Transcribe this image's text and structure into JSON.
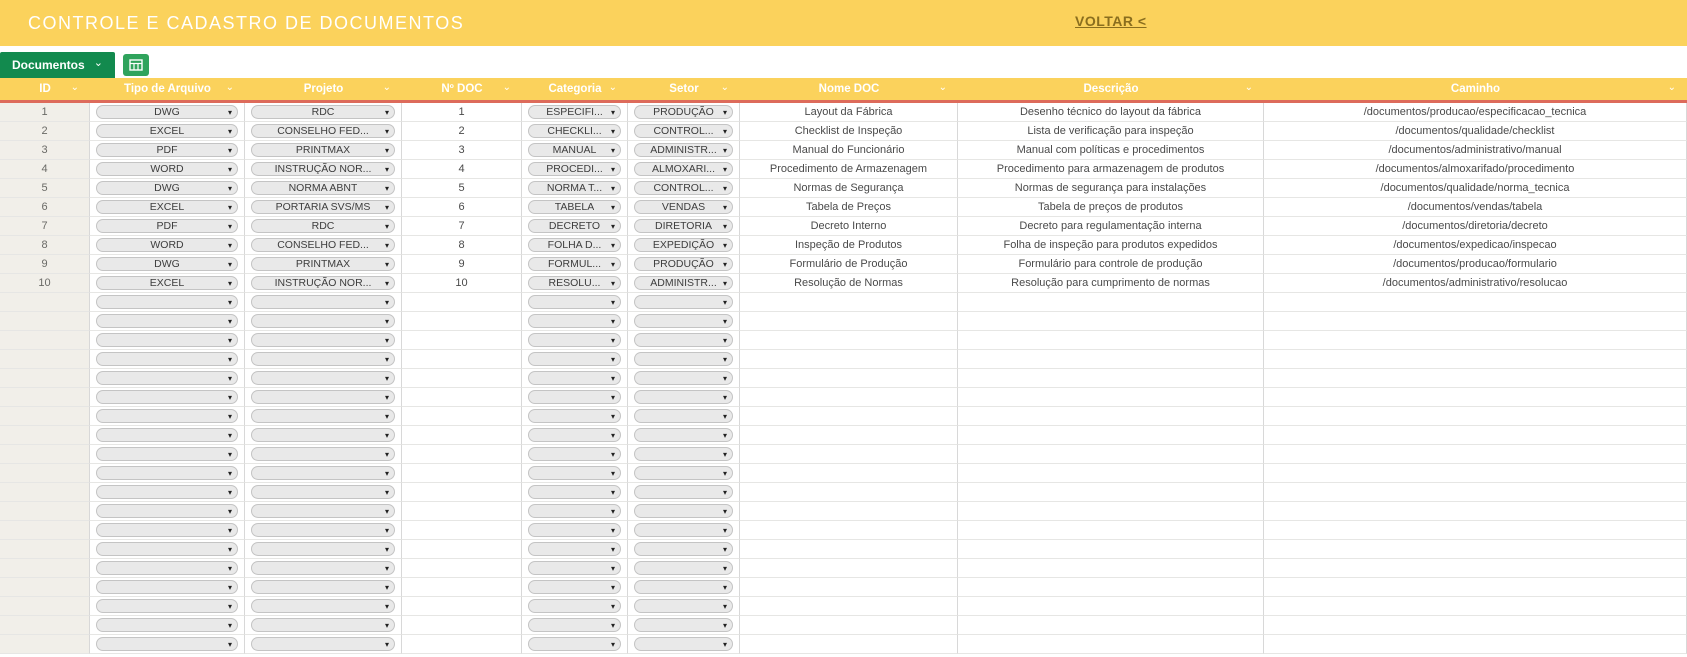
{
  "banner": {
    "title": "CONTROLE  E CADASTRO DE DOCUMENTOS",
    "back_link": "VOLTAR <"
  },
  "tabbar": {
    "tab_label": "Documentos"
  },
  "icons": {
    "chevron_down": "⌄",
    "dropdown_arrow": "▾",
    "filter_chevron": "⌄"
  },
  "colors": {
    "banner_yellow": "#FBD25C",
    "tab_green": "#128A4E",
    "icon_green": "#2FA35C",
    "divider_red": "#DD6B5B",
    "link_brown": "#8A6E1E",
    "id_column_bg": "#F1EFE9",
    "pill_gray": "#E9E9E9"
  },
  "table": {
    "columns": [
      {
        "key": "id",
        "label": "ID",
        "type": "text"
      },
      {
        "key": "tipo",
        "label": "Tipo de Arquivo",
        "type": "dropdown"
      },
      {
        "key": "projeto",
        "label": "Projeto",
        "type": "dropdown"
      },
      {
        "key": "ndoc",
        "label": "Nº DOC",
        "type": "text"
      },
      {
        "key": "categoria",
        "label": "Categoria",
        "type": "dropdown"
      },
      {
        "key": "setor",
        "label": "Setor",
        "type": "dropdown"
      },
      {
        "key": "nome",
        "label": "Nome DOC",
        "type": "text"
      },
      {
        "key": "descricao",
        "label": "Descrição",
        "type": "text"
      },
      {
        "key": "caminho",
        "label": "Caminho",
        "type": "text"
      }
    ],
    "rows": [
      {
        "id": "1",
        "tipo": "DWG",
        "projeto": "RDC",
        "ndoc": "1",
        "categoria": "ESPECIFI...",
        "setor": "PRODUÇÃO",
        "nome": "Layout da Fábrica",
        "descricao": "Desenho técnico do layout da fábrica",
        "caminho": "/documentos/producao/especificacao_tecnica"
      },
      {
        "id": "2",
        "tipo": "EXCEL",
        "projeto": "CONSELHO FED...",
        "ndoc": "2",
        "categoria": "CHECKLI...",
        "setor": "CONTROL...",
        "nome": "Checklist de Inspeção",
        "descricao": "Lista de verificação para inspeção",
        "caminho": "/documentos/qualidade/checklist"
      },
      {
        "id": "3",
        "tipo": "PDF",
        "projeto": "PRINTMAX",
        "ndoc": "3",
        "categoria": "MANUAL",
        "setor": "ADMINISTR...",
        "nome": "Manual do Funcionário",
        "descricao": "Manual com políticas e procedimentos",
        "caminho": "/documentos/administrativo/manual"
      },
      {
        "id": "4",
        "tipo": "WORD",
        "projeto": "INSTRUÇÃO NOR...",
        "ndoc": "4",
        "categoria": "PROCEDI...",
        "setor": "ALMOXARI...",
        "nome": "Procedimento de Armazenagem",
        "descricao": "Procedimento para armazenagem de produtos",
        "caminho": "/documentos/almoxarifado/procedimento"
      },
      {
        "id": "5",
        "tipo": "DWG",
        "projeto": "NORMA ABNT",
        "ndoc": "5",
        "categoria": "NORMA T...",
        "setor": "CONTROL...",
        "nome": "Normas de Segurança",
        "descricao": "Normas de segurança para instalações",
        "caminho": "/documentos/qualidade/norma_tecnica"
      },
      {
        "id": "6",
        "tipo": "EXCEL",
        "projeto": "PORTARIA SVS/MS",
        "ndoc": "6",
        "categoria": "TABELA",
        "setor": "VENDAS",
        "nome": "Tabela de Preços",
        "descricao": "Tabela de preços de produtos",
        "caminho": "/documentos/vendas/tabela"
      },
      {
        "id": "7",
        "tipo": "PDF",
        "projeto": "RDC",
        "ndoc": "7",
        "categoria": "DECRETO",
        "setor": "DIRETORIA",
        "nome": "Decreto Interno",
        "descricao": "Decreto para regulamentação interna",
        "caminho": "/documentos/diretoria/decreto"
      },
      {
        "id": "8",
        "tipo": "WORD",
        "projeto": "CONSELHO FED...",
        "ndoc": "8",
        "categoria": "FOLHA D...",
        "setor": "EXPEDIÇÃO",
        "nome": "Inspeção de Produtos",
        "descricao": "Folha de inspeção para produtos expedidos",
        "caminho": "/documentos/expedicao/inspecao"
      },
      {
        "id": "9",
        "tipo": "DWG",
        "projeto": "PRINTMAX",
        "ndoc": "9",
        "categoria": "FORMUL...",
        "setor": "PRODUÇÃO",
        "nome": "Formulário de Produção",
        "descricao": "Formulário para controle de produção",
        "caminho": "/documentos/producao/formulario"
      },
      {
        "id": "10",
        "tipo": "EXCEL",
        "projeto": "INSTRUÇÃO NOR...",
        "ndoc": "10",
        "categoria": "RESOLU...",
        "setor": "ADMINISTR...",
        "nome": "Resolução de Normas",
        "descricao": "Resolução para cumprimento de normas",
        "caminho": "/documentos/administrativo/resolucao"
      }
    ],
    "empty_rows": 19
  }
}
